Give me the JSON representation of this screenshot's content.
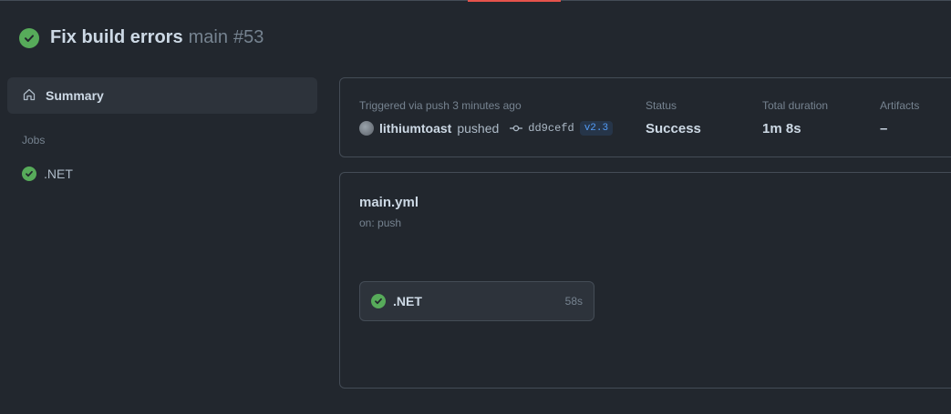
{
  "header": {
    "title": "Fix build errors",
    "branch": "main",
    "run_number": "#53"
  },
  "sidebar": {
    "summary_label": "Summary",
    "jobs_label": "Jobs",
    "jobs": [
      {
        "label": ".NET",
        "status": "success"
      }
    ]
  },
  "run_info": {
    "trigger_text": "Triggered via push 3 minutes ago",
    "user": "lithiumtoast",
    "action": "pushed",
    "commit_sha": "dd9cefd",
    "tag": "v2.3",
    "status_label": "Status",
    "status_value": "Success",
    "duration_label": "Total duration",
    "duration_value": "1m 8s",
    "artifacts_label": "Artifacts",
    "artifacts_value": "–"
  },
  "workflow": {
    "name": "main.yml",
    "trigger": "on: push",
    "jobs": [
      {
        "name": ".NET",
        "duration": "58s",
        "status": "success"
      }
    ]
  },
  "colors": {
    "success": "#57ab5a",
    "background": "#22272e",
    "accent": "#539bf5"
  }
}
